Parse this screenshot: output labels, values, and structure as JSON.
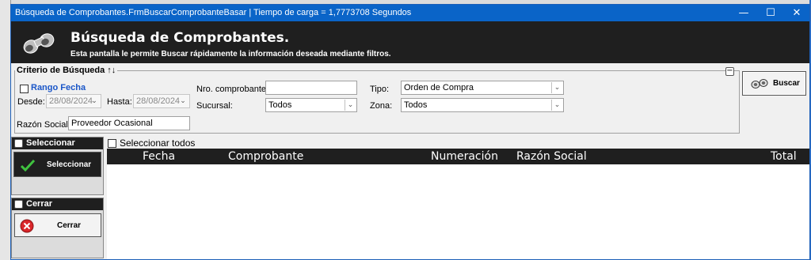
{
  "window": {
    "title": "Búsqueda de Comprobantes.FrmBuscarComprobanteBasar | Tiempo de carga = 1,7773708 Segundos",
    "minimize": "—",
    "maximize": "☐",
    "close": "✕"
  },
  "header": {
    "title": "Búsqueda de Comprobantes.",
    "subtitle": "Esta pantalla le permite Buscar rápidamente la información deseada mediante filtros."
  },
  "criteria": {
    "legend": "Criterio de Búsqueda ↑↓",
    "rango_fecha_label": "Rango Fecha",
    "desde_label": "Desde:",
    "desde_value": "28/08/2024",
    "hasta_label": "Hasta:",
    "hasta_value": "28/08/2024",
    "razon_social_label": "Razón Social:",
    "razon_social_value": "Proveedor Ocasional",
    "nro_comprobante_label": "Nro. comprobante:",
    "nro_comprobante_value": "",
    "sucursal_label": "Sucursal:",
    "sucursal_value": "Todos",
    "tipo_label": "Tipo:",
    "tipo_value": "Orden de Compra",
    "zona_label": "Zona:",
    "zona_value": "Todos"
  },
  "buttons": {
    "buscar": "Buscar",
    "seleccionar": "Seleccionar",
    "cerrar": "Cerrar"
  },
  "panels": {
    "seleccionar_title": "Seleccionar",
    "cerrar_title": "Cerrar"
  },
  "grid": {
    "select_all_label": "Seleccionar todos",
    "columns": [
      "Fecha",
      "Comprobante",
      "Numeración",
      "Razón Social",
      "Total"
    ],
    "rows": []
  },
  "colors": {
    "titlebar": "#0a64c8",
    "header_bg": "#1f1f1f",
    "link_blue": "#1a56c8"
  }
}
